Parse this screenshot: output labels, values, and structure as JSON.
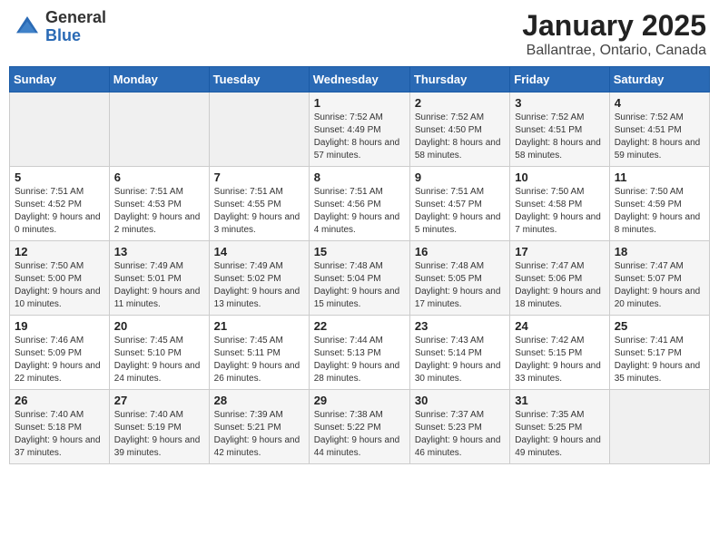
{
  "header": {
    "logo_general": "General",
    "logo_blue": "Blue",
    "title": "January 2025",
    "subtitle": "Ballantrae, Ontario, Canada"
  },
  "days_of_week": [
    "Sunday",
    "Monday",
    "Tuesday",
    "Wednesday",
    "Thursday",
    "Friday",
    "Saturday"
  ],
  "weeks": [
    [
      {
        "day": "",
        "detail": ""
      },
      {
        "day": "",
        "detail": ""
      },
      {
        "day": "",
        "detail": ""
      },
      {
        "day": "1",
        "detail": "Sunrise: 7:52 AM\nSunset: 4:49 PM\nDaylight: 8 hours and 57 minutes."
      },
      {
        "day": "2",
        "detail": "Sunrise: 7:52 AM\nSunset: 4:50 PM\nDaylight: 8 hours and 58 minutes."
      },
      {
        "day": "3",
        "detail": "Sunrise: 7:52 AM\nSunset: 4:51 PM\nDaylight: 8 hours and 58 minutes."
      },
      {
        "day": "4",
        "detail": "Sunrise: 7:52 AM\nSunset: 4:51 PM\nDaylight: 8 hours and 59 minutes."
      }
    ],
    [
      {
        "day": "5",
        "detail": "Sunrise: 7:51 AM\nSunset: 4:52 PM\nDaylight: 9 hours and 0 minutes."
      },
      {
        "day": "6",
        "detail": "Sunrise: 7:51 AM\nSunset: 4:53 PM\nDaylight: 9 hours and 2 minutes."
      },
      {
        "day": "7",
        "detail": "Sunrise: 7:51 AM\nSunset: 4:55 PM\nDaylight: 9 hours and 3 minutes."
      },
      {
        "day": "8",
        "detail": "Sunrise: 7:51 AM\nSunset: 4:56 PM\nDaylight: 9 hours and 4 minutes."
      },
      {
        "day": "9",
        "detail": "Sunrise: 7:51 AM\nSunset: 4:57 PM\nDaylight: 9 hours and 5 minutes."
      },
      {
        "day": "10",
        "detail": "Sunrise: 7:50 AM\nSunset: 4:58 PM\nDaylight: 9 hours and 7 minutes."
      },
      {
        "day": "11",
        "detail": "Sunrise: 7:50 AM\nSunset: 4:59 PM\nDaylight: 9 hours and 8 minutes."
      }
    ],
    [
      {
        "day": "12",
        "detail": "Sunrise: 7:50 AM\nSunset: 5:00 PM\nDaylight: 9 hours and 10 minutes."
      },
      {
        "day": "13",
        "detail": "Sunrise: 7:49 AM\nSunset: 5:01 PM\nDaylight: 9 hours and 11 minutes."
      },
      {
        "day": "14",
        "detail": "Sunrise: 7:49 AM\nSunset: 5:02 PM\nDaylight: 9 hours and 13 minutes."
      },
      {
        "day": "15",
        "detail": "Sunrise: 7:48 AM\nSunset: 5:04 PM\nDaylight: 9 hours and 15 minutes."
      },
      {
        "day": "16",
        "detail": "Sunrise: 7:48 AM\nSunset: 5:05 PM\nDaylight: 9 hours and 17 minutes."
      },
      {
        "day": "17",
        "detail": "Sunrise: 7:47 AM\nSunset: 5:06 PM\nDaylight: 9 hours and 18 minutes."
      },
      {
        "day": "18",
        "detail": "Sunrise: 7:47 AM\nSunset: 5:07 PM\nDaylight: 9 hours and 20 minutes."
      }
    ],
    [
      {
        "day": "19",
        "detail": "Sunrise: 7:46 AM\nSunset: 5:09 PM\nDaylight: 9 hours and 22 minutes."
      },
      {
        "day": "20",
        "detail": "Sunrise: 7:45 AM\nSunset: 5:10 PM\nDaylight: 9 hours and 24 minutes."
      },
      {
        "day": "21",
        "detail": "Sunrise: 7:45 AM\nSunset: 5:11 PM\nDaylight: 9 hours and 26 minutes."
      },
      {
        "day": "22",
        "detail": "Sunrise: 7:44 AM\nSunset: 5:13 PM\nDaylight: 9 hours and 28 minutes."
      },
      {
        "day": "23",
        "detail": "Sunrise: 7:43 AM\nSunset: 5:14 PM\nDaylight: 9 hours and 30 minutes."
      },
      {
        "day": "24",
        "detail": "Sunrise: 7:42 AM\nSunset: 5:15 PM\nDaylight: 9 hours and 33 minutes."
      },
      {
        "day": "25",
        "detail": "Sunrise: 7:41 AM\nSunset: 5:17 PM\nDaylight: 9 hours and 35 minutes."
      }
    ],
    [
      {
        "day": "26",
        "detail": "Sunrise: 7:40 AM\nSunset: 5:18 PM\nDaylight: 9 hours and 37 minutes."
      },
      {
        "day": "27",
        "detail": "Sunrise: 7:40 AM\nSunset: 5:19 PM\nDaylight: 9 hours and 39 minutes."
      },
      {
        "day": "28",
        "detail": "Sunrise: 7:39 AM\nSunset: 5:21 PM\nDaylight: 9 hours and 42 minutes."
      },
      {
        "day": "29",
        "detail": "Sunrise: 7:38 AM\nSunset: 5:22 PM\nDaylight: 9 hours and 44 minutes."
      },
      {
        "day": "30",
        "detail": "Sunrise: 7:37 AM\nSunset: 5:23 PM\nDaylight: 9 hours and 46 minutes."
      },
      {
        "day": "31",
        "detail": "Sunrise: 7:35 AM\nSunset: 5:25 PM\nDaylight: 9 hours and 49 minutes."
      },
      {
        "day": "",
        "detail": ""
      }
    ]
  ]
}
